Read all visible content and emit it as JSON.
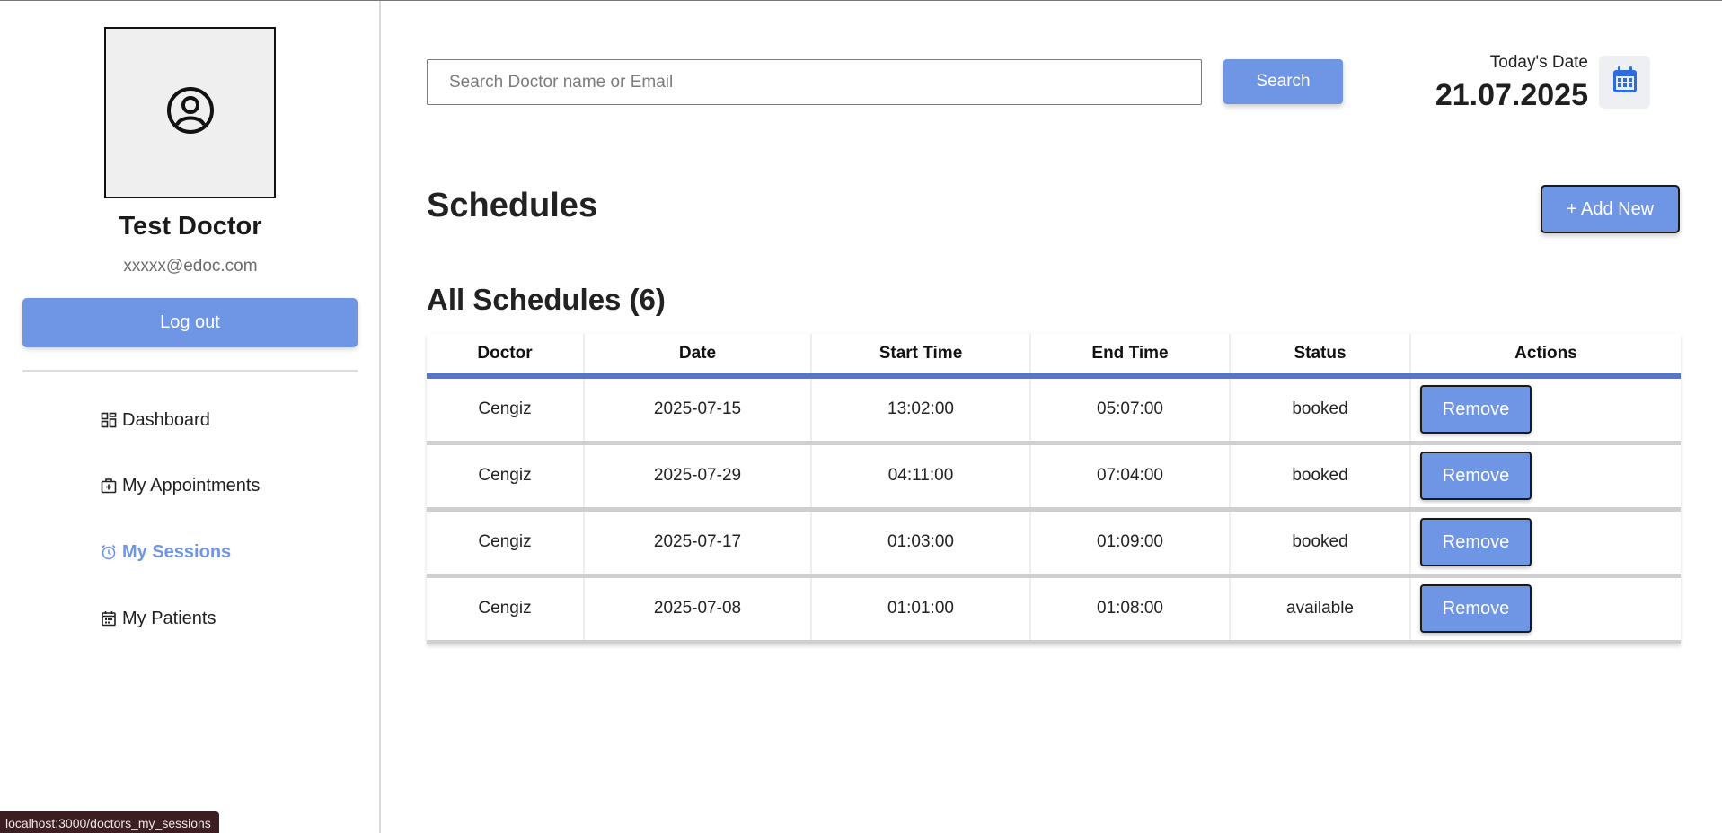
{
  "profile": {
    "name": "Test Doctor",
    "email": "xxxxx@edoc.com",
    "avatar_icon": "user-circle-icon"
  },
  "sidebar": {
    "logout_label": "Log out",
    "items": [
      {
        "label": "Dashboard",
        "icon": "dashboard-grid-icon",
        "active": false
      },
      {
        "label": "My Appointments",
        "icon": "medical-bag-icon",
        "active": false
      },
      {
        "label": "My Sessions",
        "icon": "alarm-clock-icon",
        "active": true
      },
      {
        "label": "My Patients",
        "icon": "calendar-icon",
        "active": false
      }
    ]
  },
  "search": {
    "placeholder": "Search Doctor name or Email",
    "value": "",
    "button_label": "Search"
  },
  "date": {
    "label": "Today's Date",
    "value": "21.07.2025",
    "icon": "calendar-icon"
  },
  "page": {
    "title": "Schedules",
    "add_new_label": "+ Add New",
    "section_title": "All Schedules (6)"
  },
  "table": {
    "columns": [
      "Doctor",
      "Date",
      "Start Time",
      "End Time",
      "Status",
      "Actions"
    ],
    "rows": [
      {
        "doctor": "Cengiz",
        "date": "2025-07-15",
        "start": "13:02:00",
        "end": "05:07:00",
        "status": "booked",
        "action": "Remove"
      },
      {
        "doctor": "Cengiz",
        "date": "2025-07-29",
        "start": "04:11:00",
        "end": "07:04:00",
        "status": "booked",
        "action": "Remove"
      },
      {
        "doctor": "Cengiz",
        "date": "2025-07-17",
        "start": "01:03:00",
        "end": "01:09:00",
        "status": "booked",
        "action": "Remove"
      },
      {
        "doctor": "Cengiz",
        "date": "2025-07-08",
        "start": "01:01:00",
        "end": "01:08:00",
        "status": "available",
        "action": "Remove"
      }
    ]
  },
  "status_bar": {
    "url": "localhost:3000/doctors_my_sessions"
  },
  "colors": {
    "accent": "#6f95e5",
    "table_header_border": "#5577c7",
    "active_nav": "#6f95e5"
  }
}
